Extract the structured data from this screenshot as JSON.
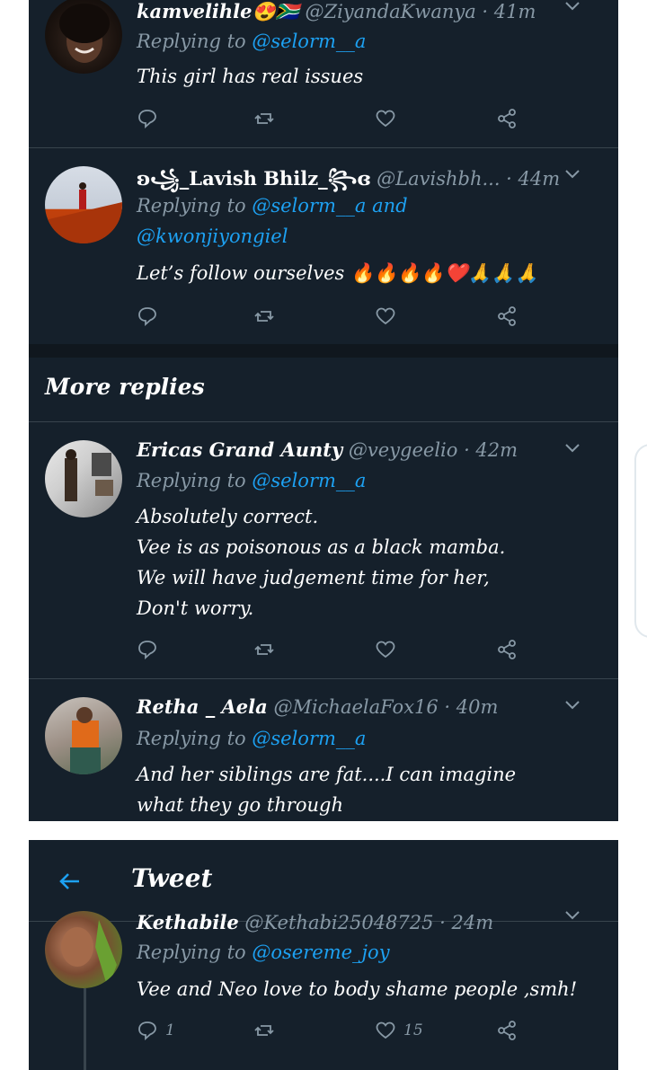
{
  "tweets_top": [
    {
      "name": "kamvelihle😍🇿🇦",
      "handle": "@ZiyandaKwanya · 41m",
      "replying_prefix": "Replying to ",
      "replying_to": "@selorm__a",
      "lines": [
        "This girl has real issues"
      ]
    },
    {
      "name": "ʚ꧁_Lavish Bhilz_꧂ɞ",
      "handle": "@Lavishbh... · 44m",
      "replying_prefix": "Replying to ",
      "replying_to": "@selorm__a and",
      "replying_to_2": "@kwonjiyongiel",
      "lines": [
        "Let’s follow ourselves 🔥🔥🔥🔥❤️🙏🙏🙏"
      ]
    }
  ],
  "more_replies": {
    "label": "More replies"
  },
  "tweets_more": [
    {
      "name": "Ericas Grand Aunty",
      "handle": "@veygeelio · 42m",
      "replying_prefix": "Replying to ",
      "replying_to": "@selorm__a",
      "lines": [
        "Absolutely correct.",
        "Vee is as poisonous as a black mamba.",
        "We will have judgement time for her,",
        "Don't worry."
      ]
    },
    {
      "name": "Retha _ Aela",
      "handle": "@MichaelaFox16 · 40m",
      "replying_prefix": "Replying to ",
      "replying_to": "@selorm__a",
      "lines": [
        "And her siblings are fat....I can imagine",
        "what they go through"
      ]
    }
  ],
  "second_screen": {
    "title": "Tweet",
    "tweet": {
      "name": "Kethabile",
      "handle": "@Kethabi25048725 · 24m",
      "replying_prefix": "Replying to ",
      "replying_to": "@osereme_joy",
      "lines": [
        "Vee and Neo love to body shame people ,smh!"
      ],
      "reply_count": "1",
      "like_count": "15"
    }
  },
  "icons": {
    "reply": "reply-icon",
    "retweet": "retweet-icon",
    "like": "like-icon",
    "share": "share-icon",
    "back": "back-arrow-icon",
    "chevron": "chevron-down-icon"
  },
  "colors": {
    "background": "#15202b",
    "text": "#ffffff",
    "muted": "#8899a6",
    "accent": "#1da1f2",
    "divider": "#38444d"
  }
}
